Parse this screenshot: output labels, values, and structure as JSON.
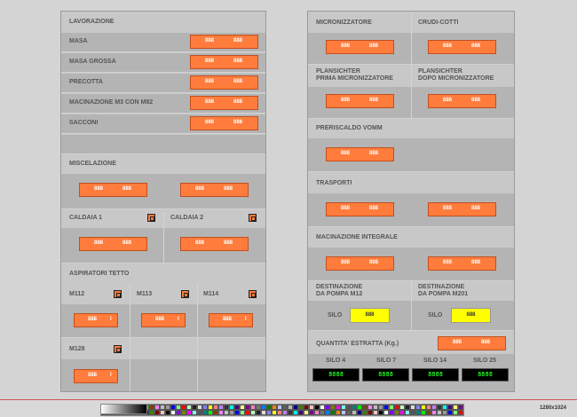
{
  "left": {
    "lavorazione_title": "LAVORAZIONE",
    "rows": [
      {
        "label": "MASA",
        "v1": "888",
        "v2": "888"
      },
      {
        "label": "MASA GROSSA",
        "v1": "888",
        "v2": "888"
      },
      {
        "label": "PRECOTTA",
        "v1": "888",
        "v2": "888"
      },
      {
        "label": "MACINAZIONE M3 CON M82",
        "v1": "888",
        "v2": "888"
      },
      {
        "label": "SACCONI",
        "v1": "888",
        "v2": "888"
      }
    ],
    "miscelazione_title": "MISCELAZIONE",
    "miscelazione": [
      {
        "v1": "888",
        "v2": "888"
      },
      {
        "v1": "888",
        "v2": "888"
      }
    ],
    "caldaia1": {
      "label": "CALDAIA 1",
      "v1": "888",
      "v2": "888"
    },
    "caldaia2": {
      "label": "CALDAIA 2",
      "v1": "888",
      "v2": "888"
    },
    "aspiratori_title": "ASPIRATORI TETTO",
    "aspiratori": [
      {
        "label": "M112",
        "v": "888",
        "unit": "l"
      },
      {
        "label": "M113",
        "v": "888",
        "unit": "l"
      },
      {
        "label": "M114",
        "v": "888",
        "unit": "l"
      },
      {
        "label": "M128",
        "v": "888",
        "unit": "l"
      }
    ]
  },
  "right": {
    "micronizzatore": {
      "label": "MICRONIZZATORE",
      "v1": "888",
      "v2": "888"
    },
    "crudi_cotti": {
      "label": "CRUDI-COTTI",
      "v1": "888",
      "v2": "888"
    },
    "plansichter1": {
      "line1": "PLANSICHTER",
      "line2": "PRIMA MICRONIZZATORE",
      "v1": "888",
      "v2": "888"
    },
    "plansichter2": {
      "line1": "PLANSICHTER",
      "line2": "DOPO MICRONIZZATORE",
      "v1": "888",
      "v2": "888"
    },
    "preriscaldo": {
      "label": "PRERISCALDO VOMM",
      "v1": "888",
      "v2": "888"
    },
    "trasporti": {
      "label": "TRASPORTI",
      "a1": "888",
      "a2": "888",
      "b1": "888",
      "b2": "888"
    },
    "macinazione": {
      "label": "MACINAZIONE INTEGRALE",
      "a1": "888",
      "a2": "888",
      "b1": "888",
      "b2": "888"
    },
    "destinazione1": {
      "line1": "DESTINAZIONE",
      "line2": "DA POMPA M12",
      "silo_label": "SILO",
      "value": "888"
    },
    "destinazione2": {
      "line1": "DESTINAZIONE",
      "line2": "DA POMPA M201",
      "silo_label": "SILO",
      "value": "888"
    },
    "quantita": {
      "label": "QUANTITA' ESTRATTA (Kg.)",
      "v1": "888",
      "v2": "888"
    },
    "silos": [
      {
        "label": "SILO 4",
        "value": "8888"
      },
      {
        "label": "SILO 7",
        "value": "8888"
      },
      {
        "label": "SILO 14",
        "value": "8888"
      },
      {
        "label": "SILO 25",
        "value": "8888"
      }
    ]
  },
  "taskbar": {
    "resolution": "1280x1024"
  },
  "colors": {
    "accent": "#ff7c3c",
    "panel": "#c8c8c8",
    "band": "#b4b4b4",
    "highlight": "#ffff00",
    "display": "#22ee22"
  }
}
